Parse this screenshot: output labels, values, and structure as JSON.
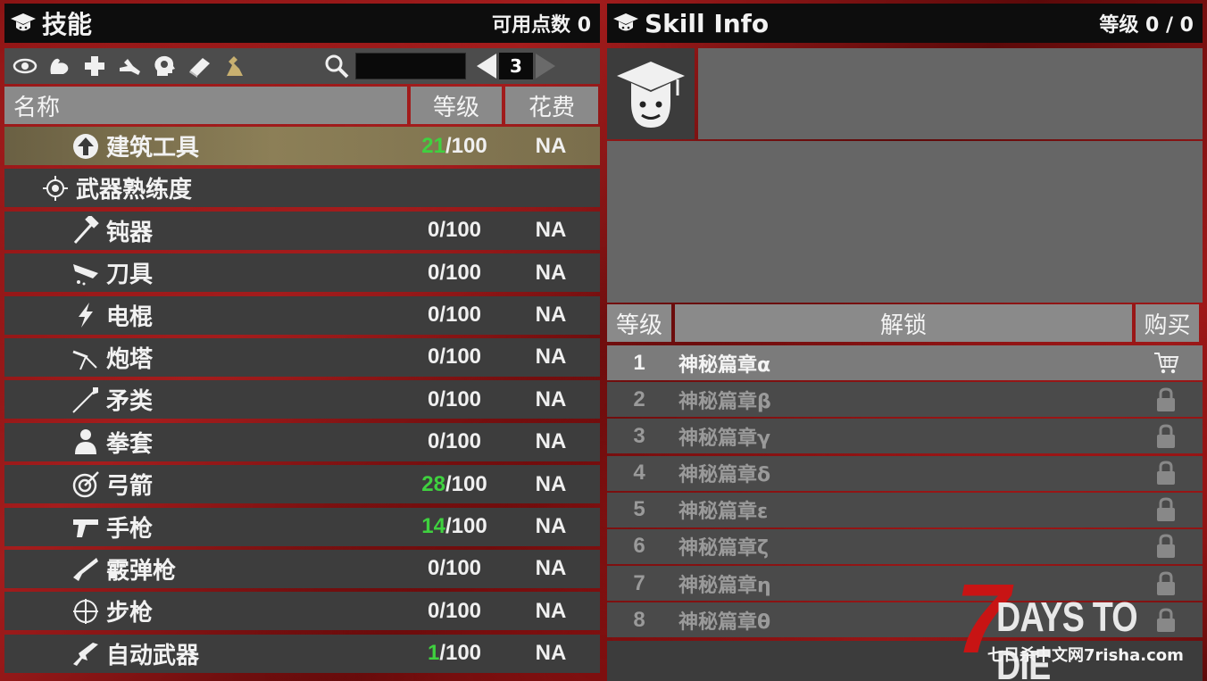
{
  "left_panel": {
    "title": "技能",
    "points_label": "可用点数 0",
    "toolbar": {
      "categories": [
        "eye-icon",
        "strength-icon",
        "health-icon",
        "agility-icon",
        "mind-icon",
        "book-icon",
        "skill-icon"
      ],
      "search_value": "",
      "page": "3"
    },
    "columns": {
      "name": "名称",
      "level": "等级",
      "cost": "花费"
    },
    "skills": [
      {
        "name": "建筑工具",
        "icon": "upgrade-arrow-icon",
        "level_cur": "21",
        "level_max": "/100",
        "cost": "NA",
        "selected": true,
        "green": true
      },
      {
        "name": "武器熟练度",
        "icon": "weapon-group-icon",
        "group": true
      },
      {
        "name": "钝器",
        "icon": "hammer-icon",
        "level_cur": "0",
        "level_max": "/100",
        "cost": "NA"
      },
      {
        "name": "刀具",
        "icon": "blade-icon",
        "level_cur": "0",
        "level_max": "/100",
        "cost": "NA"
      },
      {
        "name": "电棍",
        "icon": "lightning-icon",
        "level_cur": "0",
        "level_max": "/100",
        "cost": "NA"
      },
      {
        "name": "炮塔",
        "icon": "turret-icon",
        "level_cur": "0",
        "level_max": "/100",
        "cost": "NA"
      },
      {
        "name": "矛类",
        "icon": "spear-icon",
        "level_cur": "0",
        "level_max": "/100",
        "cost": "NA"
      },
      {
        "name": "拳套",
        "icon": "fist-icon",
        "level_cur": "0",
        "level_max": "/100",
        "cost": "NA"
      },
      {
        "name": "弓箭",
        "icon": "target-icon",
        "level_cur": "28",
        "level_max": "/100",
        "cost": "NA",
        "green": true
      },
      {
        "name": "手枪",
        "icon": "pistol-icon",
        "level_cur": "14",
        "level_max": "/100",
        "cost": "NA",
        "green": true
      },
      {
        "name": "霰弹枪",
        "icon": "shotgun-icon",
        "level_cur": "0",
        "level_max": "/100",
        "cost": "NA"
      },
      {
        "name": "步枪",
        "icon": "crosshair-icon",
        "level_cur": "0",
        "level_max": "/100",
        "cost": "NA"
      },
      {
        "name": "自动武器",
        "icon": "rifle-icon",
        "level_cur": "1",
        "level_max": "/100",
        "cost": "NA",
        "green": true
      }
    ]
  },
  "right_panel": {
    "title": "Skill Info",
    "level_label": "等级 0 / 0",
    "columns": {
      "level": "等级",
      "unlock": "解锁",
      "buy": "购买"
    },
    "unlocks": [
      {
        "level": "1",
        "name": "神秘篇章α",
        "state": "cart-icon",
        "active": true
      },
      {
        "level": "2",
        "name": "神秘篇章β",
        "state": "lock-icon"
      },
      {
        "level": "3",
        "name": "神秘篇章γ",
        "state": "lock-icon"
      },
      {
        "level": "4",
        "name": "神秘篇章δ",
        "state": "lock-icon"
      },
      {
        "level": "5",
        "name": "神秘篇章ε",
        "state": "lock-icon"
      },
      {
        "level": "6",
        "name": "神秘篇章ζ",
        "state": "lock-icon"
      },
      {
        "level": "7",
        "name": "神秘篇章η",
        "state": "lock-icon"
      },
      {
        "level": "8",
        "name": "神秘篇章θ",
        "state": "lock-icon"
      }
    ]
  },
  "logo": {
    "seven": "7",
    "days": "DAYS TO DIE",
    "sub": "七日杀中文网7risha.com"
  },
  "colors": {
    "green_level": "#3fd13f",
    "selected_row": "#8c7f57",
    "header_gray": "#8a8a8a"
  }
}
